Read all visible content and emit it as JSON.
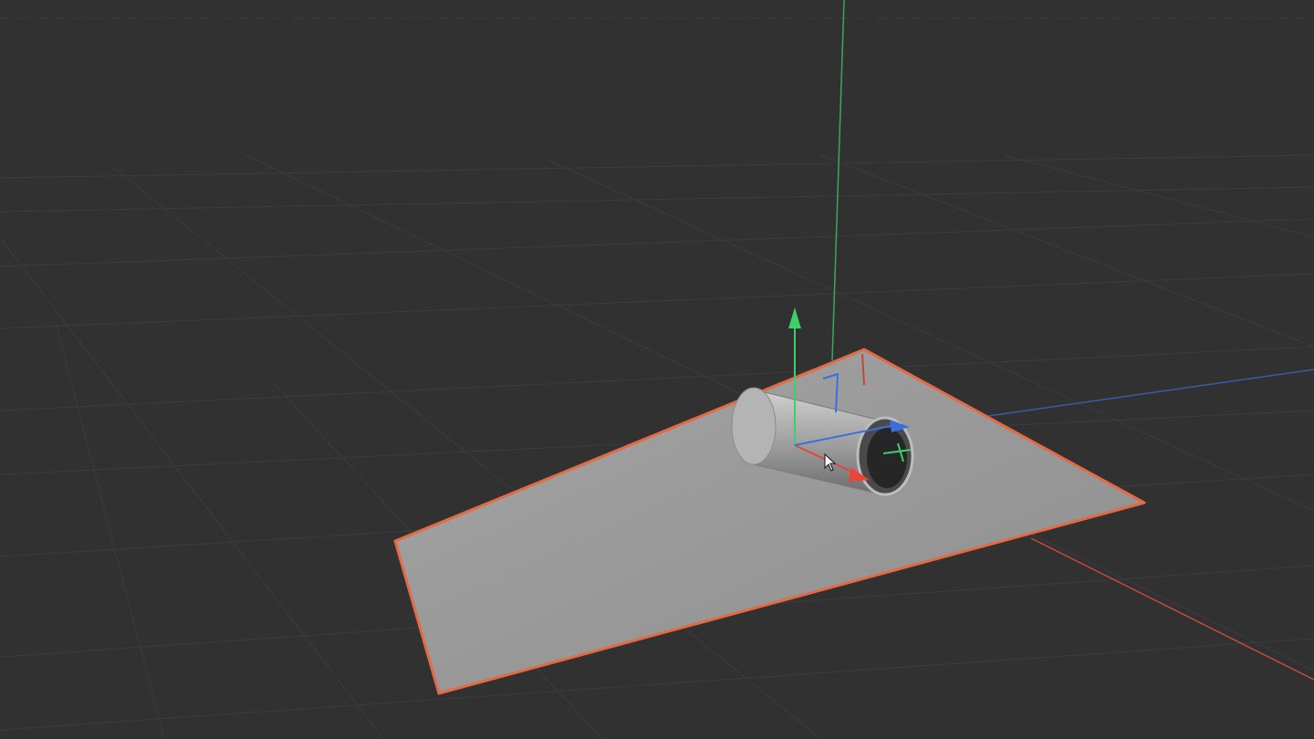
{
  "viewport": {
    "background": "#313131",
    "grid_color": "#3c3c3c",
    "grid_major_color": "#454545",
    "axis_colors": {
      "x": "#c0493a",
      "y": "#3aa85a",
      "z": "#3a5aa8"
    }
  },
  "scene": {
    "plane": {
      "fill": "#9a9a9a",
      "selection_outline": "#e36a45"
    },
    "cylinder": {
      "fill": "#a8a8a8",
      "cap": "#2a2a2a"
    },
    "gizmo": {
      "mode": "move",
      "x_color": "#e8453c",
      "y_color": "#3ccf6a",
      "z_color": "#3a6fe0"
    }
  },
  "icons": {
    "cursor": "arrow-cursor-icon"
  }
}
